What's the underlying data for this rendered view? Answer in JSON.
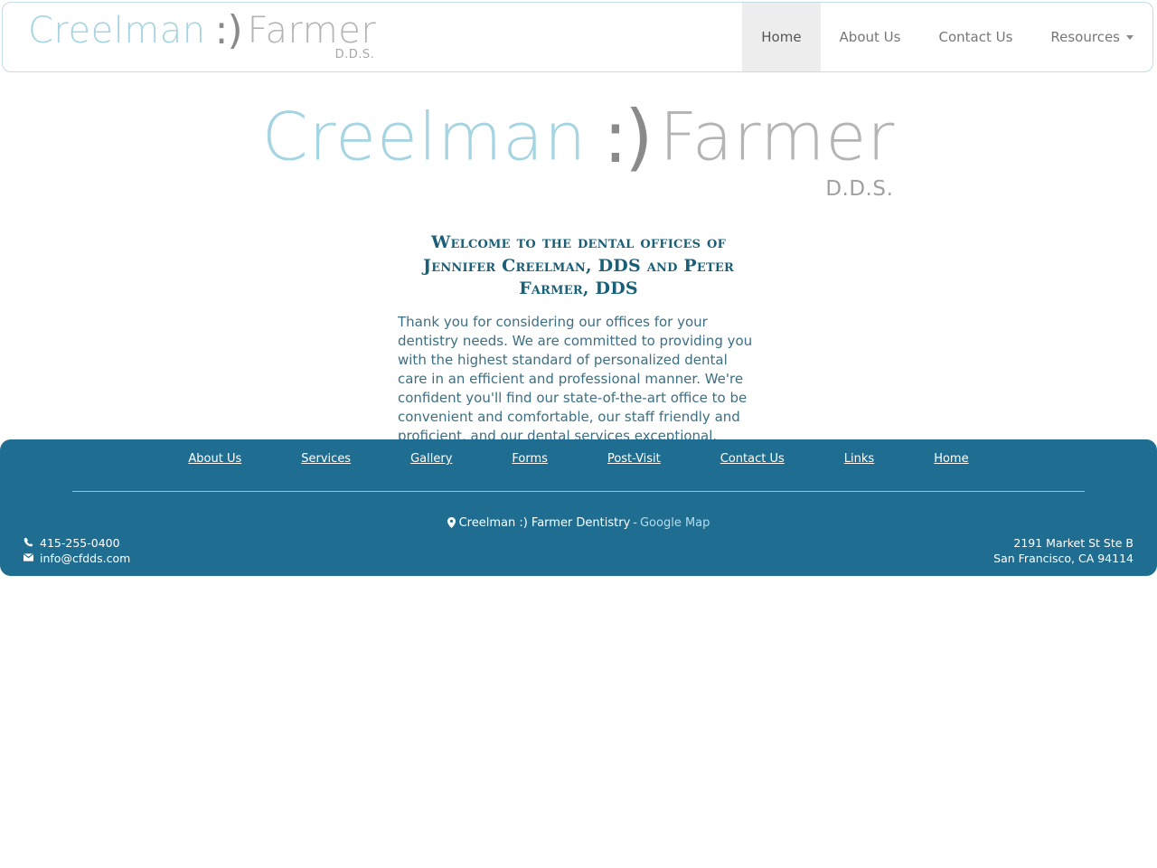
{
  "header": {
    "brand": {
      "first_name": "Creelman",
      "smile": ":)",
      "last_name": "Farmer",
      "credential": "D.D.S."
    },
    "nav": [
      {
        "label": "Home",
        "active": true,
        "has_caret": false
      },
      {
        "label": "About Us",
        "active": false,
        "has_caret": false
      },
      {
        "label": "Contact Us",
        "active": false,
        "has_caret": false
      },
      {
        "label": "Resources",
        "active": false,
        "has_caret": true
      }
    ]
  },
  "hero": {
    "first_name": "Creelman",
    "smile": ":)",
    "last_name": "Farmer",
    "credential": "D.D.S."
  },
  "main": {
    "heading": "Welcome to the dental offices of Jennifer Creelman, DDS and Peter Farmer, DDS",
    "body": "Thank you for considering our offices for your dentistry needs. We are committed to providing you with the highest standard of personalized dental care in an efficient and professional manner. We're confident you'll find our state-of-the-art office to be convenient and comfortable, our staff friendly and proficient, and our dental services exceptional."
  },
  "footer": {
    "links": [
      {
        "label": "About Us"
      },
      {
        "label": "Services"
      },
      {
        "label": "Gallery"
      },
      {
        "label": "Forms"
      },
      {
        "label": "Post-Visit"
      },
      {
        "label": "Contact Us"
      },
      {
        "label": "Links"
      },
      {
        "label": "Home"
      }
    ],
    "practice_name": "Creelman :) Farmer Dentistry",
    "separator": "-",
    "map_link_label": "Google Map",
    "phone": "415-255-0400",
    "email": "info@cfdds.com",
    "address_line1": "2191 Market St Ste B",
    "address_line2": "San Francisco, CA  94114"
  },
  "colors": {
    "footer_bg": "#1f6d90",
    "heading_teal": "#1a5f78",
    "body_teal": "#3d6f82",
    "brand_blue": "#a5d4e2",
    "brand_gray": "#b4b4b4",
    "header_border": "#c3dde4",
    "active_tab_bg": "#ededed"
  }
}
